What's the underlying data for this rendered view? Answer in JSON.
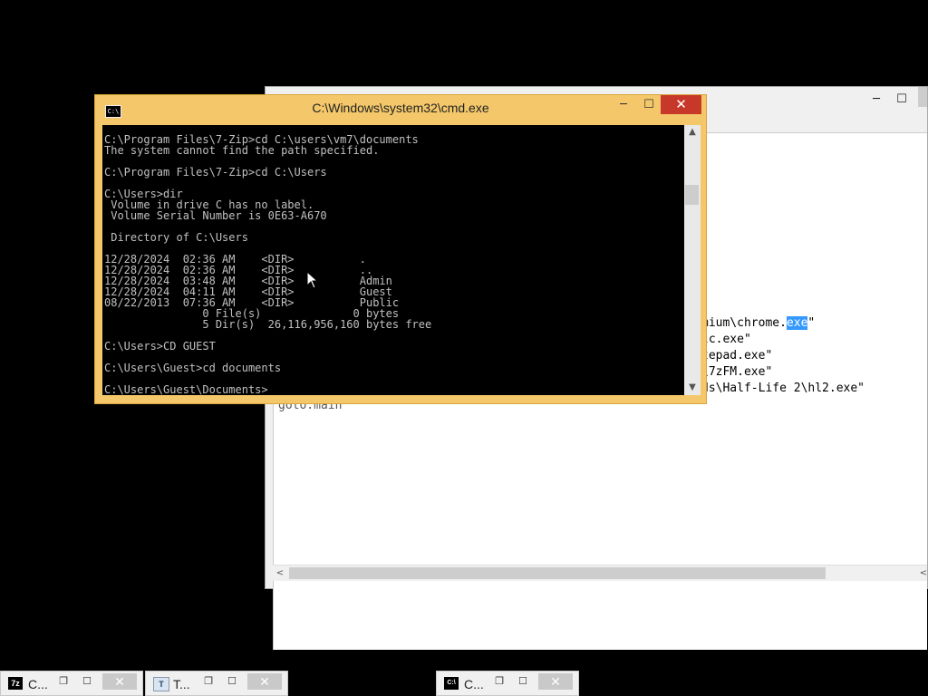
{
  "notepad": {
    "controls": {
      "minimize": "─",
      "maximize": "☐"
    },
    "lines": [
      {
        "pre": "mium\\chrome.",
        "hl": "exe",
        "post": "\""
      },
      {
        "pre": "lc.exe\"",
        "hl": "",
        "post": ""
      },
      {
        "pre": "tepad.exe\"",
        "hl": "",
        "post": ""
      },
      {
        "pre": "\\7zFM.exe\"",
        "hl": "",
        "post": ""
      },
      {
        "pre": "ds\\Half-Life 2\\hl2.exe\"",
        "hl": "",
        "post": ""
      }
    ],
    "goto_line": "goto:main",
    "hscroll_left": "<",
    "hscroll_right": "<"
  },
  "cmd": {
    "title": "C:\\Windows\\system32\\cmd.exe",
    "icon_text": "C:\\",
    "controls": {
      "minimize": "─",
      "maximize": "☐",
      "close": "✕"
    },
    "console_lines": [
      "C:\\Program Files\\7-Zip>cd C:\\users\\vm7\\documents",
      "The system cannot find the path specified.",
      "",
      "C:\\Program Files\\7-Zip>cd C:\\Users",
      "",
      "C:\\Users>dir",
      " Volume in drive C has no label.",
      " Volume Serial Number is 0E63-A670",
      "",
      " Directory of C:\\Users",
      "",
      "12/28/2024  02:36 AM    <DIR>          .",
      "12/28/2024  02:36 AM    <DIR>          ..",
      "12/28/2024  03:48 AM    <DIR>          Admin",
      "12/28/2024  04:11 AM    <DIR>          Guest",
      "08/22/2013  07:36 AM    <DIR>          Public",
      "               0 File(s)              0 bytes",
      "               5 Dir(s)  26,116,956,160 bytes free",
      "",
      "C:\\Users>CD GUEST",
      "",
      "C:\\Users\\Guest>cd documents",
      "",
      "C:\\Users\\Guest\\Documents>"
    ],
    "scroll_up": "▲",
    "scroll_down": "▼"
  },
  "taskbar_minimized": [
    {
      "label": "C...",
      "icon": "7z",
      "icon_name": "7zip-icon"
    },
    {
      "label": "T...",
      "icon": "T",
      "icon_name": "task-manager-icon"
    },
    {
      "label": "C...",
      "icon": "C:\\",
      "icon_name": "cmd-icon"
    }
  ],
  "mini_controls": {
    "restore": "❐",
    "maximize": "☐",
    "close": "✕"
  },
  "colors": {
    "desktop": "#000000",
    "cmd_frame": "#f4c86a",
    "close_red": "#c7382b",
    "console_text": "#c0c0c0"
  }
}
